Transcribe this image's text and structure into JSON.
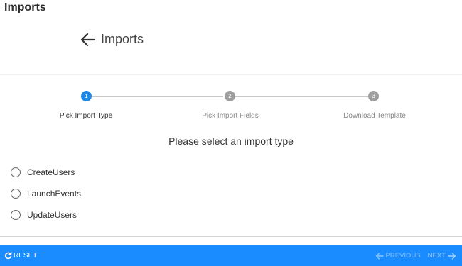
{
  "header": {
    "title": "Imports"
  },
  "back": {
    "label": "Imports"
  },
  "stepper": {
    "steps": [
      {
        "number": "1",
        "label": "Pick Import Type",
        "state": "active"
      },
      {
        "number": "2",
        "label": "Pick Import Fields",
        "state": "inactive"
      },
      {
        "number": "3",
        "label": "Download Template",
        "state": "inactive"
      }
    ]
  },
  "form": {
    "prompt": "Please select an import type",
    "options": [
      {
        "label": "CreateUsers",
        "selected": false
      },
      {
        "label": "LaunchEvents",
        "selected": false
      },
      {
        "label": "UpdateUsers",
        "selected": false
      }
    ]
  },
  "footer": {
    "reset_label": "RESET",
    "previous_label": "PREVIOUS",
    "next_label": "NEXT"
  },
  "colors": {
    "accent": "#1a8cff",
    "active_step": "#1e88e5",
    "inactive_step": "#9e9e9e"
  }
}
